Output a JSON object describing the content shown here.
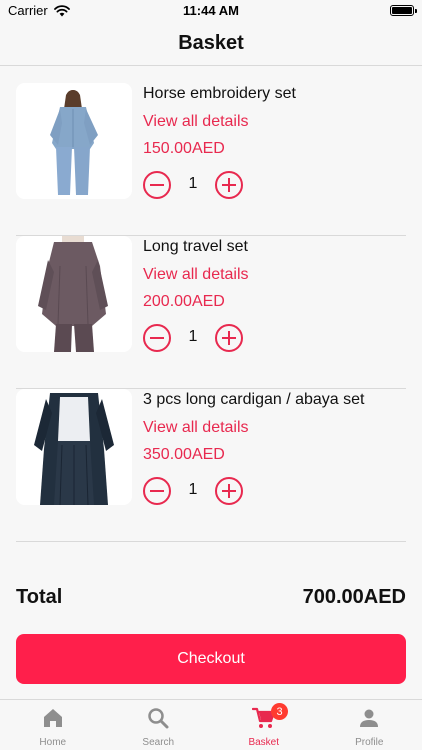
{
  "status_bar": {
    "carrier": "Carrier",
    "time": "11:44 AM"
  },
  "header": {
    "title": "Basket"
  },
  "items": [
    {
      "name": "Horse embroidery set",
      "details_label": "View all details",
      "price": "150.00AED",
      "quantity": "1",
      "image": "light-blue-denim-set"
    },
    {
      "name": "Long travel set",
      "details_label": "View all details",
      "price": "200.00AED",
      "quantity": "1",
      "image": "grey-purple-long-tunic-set"
    },
    {
      "name": "3 pcs long cardigan / abaya set",
      "details_label": "View all details",
      "price": "350.00AED",
      "quantity": "1",
      "image": "navy-cardigan-abaya-set"
    }
  ],
  "summary": {
    "total_label": "Total",
    "total_value": "700.00AED"
  },
  "checkout": {
    "label": "Checkout"
  },
  "tabs": [
    {
      "label": "Home",
      "icon": "home-icon",
      "active": false
    },
    {
      "label": "Search",
      "icon": "search-icon",
      "active": false
    },
    {
      "label": "Basket",
      "icon": "cart-icon",
      "active": true,
      "badge": "3"
    },
    {
      "label": "Profile",
      "icon": "person-icon",
      "active": false
    }
  ],
  "colors": {
    "accent": "#e8294f",
    "checkout_bg": "#ff1f4b",
    "badge": "#ff3b30",
    "inactive_tab": "#8e8e8e"
  }
}
